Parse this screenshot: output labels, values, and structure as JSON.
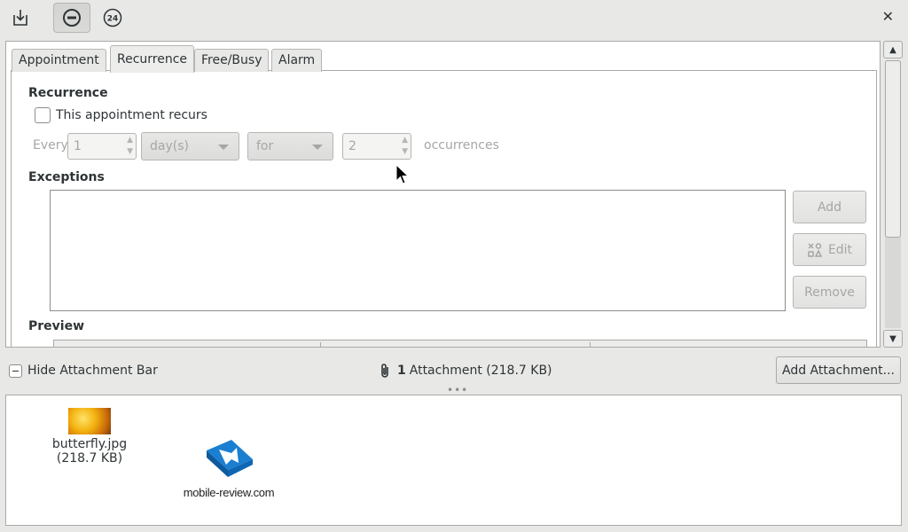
{
  "toolbar": {
    "buttons": [
      {
        "name": "save-download-icon"
      },
      {
        "name": "no-entry-icon"
      },
      {
        "name": "24h-icon",
        "label": "24"
      }
    ],
    "close_label": "✕"
  },
  "tabs": [
    "Appointment",
    "Recurrence",
    "Free/Busy",
    "Alarm"
  ],
  "active_tab": "Recurrence",
  "recurrence": {
    "section_title": "Recurrence",
    "checkbox_label": "This appointment recurs",
    "checked": false,
    "every_label": "Every",
    "interval_value": "1",
    "unit_value": "day(s)",
    "duration_value": "for",
    "count_value": "2",
    "count_suffix": "occurrences"
  },
  "exceptions": {
    "section_title": "Exceptions",
    "add_label": "Add",
    "edit_label": "Edit",
    "remove_label": "Remove"
  },
  "preview": {
    "section_title": "Preview"
  },
  "attachment_bar": {
    "hide_label": "Hide Attachment Bar",
    "count": "1",
    "count_text": "Attachment (218.7 KB)",
    "add_label": "Add Attachment..."
  },
  "attachments": [
    {
      "name": "butterfly.jpg",
      "size": "(218.7 KB)"
    }
  ],
  "watermark": {
    "text": "mobile-review.com"
  },
  "colors": {
    "disabled_text": "#a5a7a5",
    "window_bg": "#e8e8e7"
  }
}
